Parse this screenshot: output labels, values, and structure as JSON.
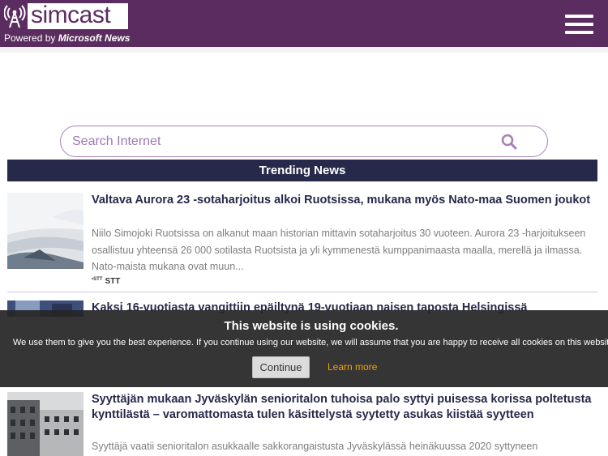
{
  "header": {
    "brand": "simcast",
    "powered_prefix": "Powered by ",
    "powered_brand": "Microsoft News",
    "menu_icon": "hamburger-menu-icon",
    "bg_color": "#5b2c5f"
  },
  "search": {
    "placeholder": "Search Internet",
    "value": "",
    "icon": "search-icon"
  },
  "trending": {
    "label": "Trending News",
    "bg_color": "#27294a"
  },
  "news": [
    {
      "title": "Valtava Aurora 23 -sotaharjoitus alkoi Ruotsissa, mukana myös Nato-maa Suomen joukot",
      "summary": "Niilo Simojoki Ruotsissa on alkanut maan historian mittavin sotaharjoitus 30 vuoteen. Aurora 23 -harjoitukseen osallistuu yhteensä 26 000 sotilasta Ruotsista ja yli kymmenestä kumppanimaasta maalla, merellä ja ilmassa. Nato-maista mukana ovat muun...",
      "source_logo": "•STT",
      "source": "STT"
    },
    {
      "title": "Kaksi 16-vuotiasta vangittiin epäiltynä 19-vuotiaan naisen taposta Helsingissä",
      "summary": "",
      "source_logo": "",
      "source": ""
    },
    {
      "title": "Syyttäjän mukaan Jyväskylän senioritalon tuhoisa palo syttyi puisessa korissa poltetusta kynttilästä – varomattomasta tulen käsittelystä syytetty asukas kiistää syytteen",
      "summary": "Syyttäjä vaatii senioritalon asukkaalle sakkorangaistusta Jyväskylässä heinäkuussa 2020 syttyneen",
      "source_logo": "",
      "source": ""
    }
  ],
  "cookie": {
    "title": "This website is using cookies.",
    "text": "We use them to give you the best experience. If you continue using our website, we will assume that you are happy to receive all cookies on this website.",
    "continue_label": "Continue",
    "learn_more_label": "Learn more",
    "link_color": "#f5a300"
  }
}
